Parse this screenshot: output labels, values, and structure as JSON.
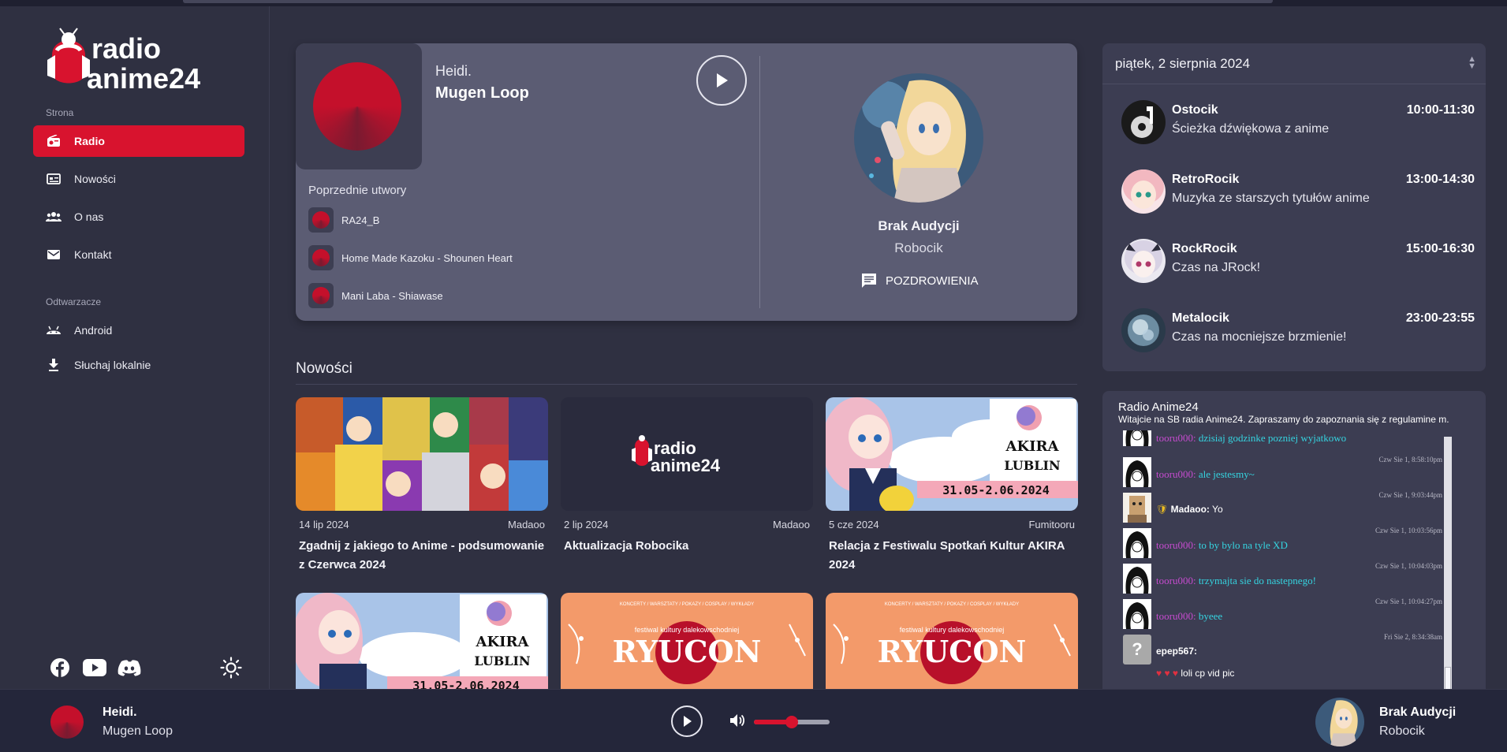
{
  "app": {
    "logo_text_line1": "radio",
    "logo_text_line2": "anime24",
    "accent_color": "#d8132e"
  },
  "sidebar": {
    "section_strona": "Strona",
    "section_odtwarzacze": "Odtwarzacze",
    "items": [
      {
        "label": "Radio",
        "icon": "radio-icon",
        "active": true
      },
      {
        "label": "Nowości",
        "icon": "news-icon"
      },
      {
        "label": "O nas",
        "icon": "people-icon"
      },
      {
        "label": "Kontakt",
        "icon": "mail-icon"
      }
    ],
    "players": [
      {
        "label": "Android",
        "icon": "android-icon"
      },
      {
        "label": "Słuchaj lokalnie",
        "icon": "download-icon"
      }
    ],
    "social": [
      "facebook-icon",
      "youtube-icon",
      "discord-icon"
    ],
    "theme_toggle": "sun-icon"
  },
  "now_playing": {
    "artist": "Heidi.",
    "title": "Mugen Loop",
    "previous_label": "Poprzednie utwory",
    "previous": [
      "RA24_B",
      "Home Made Kazoku - Shounen Heart",
      "Mani Laba - Shiawase"
    ],
    "host_name": "Brak Audycji",
    "host_sub": "Robocik",
    "greetings_label": "POZDROWIENIA"
  },
  "news": {
    "title": "Nowości",
    "cards": [
      {
        "date": "14 lip 2024",
        "author": "Madaoo",
        "headline": "Zgadnij z jakiego to Anime - podsumowanie z Czerwca 2024"
      },
      {
        "date": "2 lip 2024",
        "author": "Madaoo",
        "headline": "Aktualizacja Robocika"
      },
      {
        "date": "5 cze 2024",
        "author": "Fumitooru",
        "headline": "Relacja z Festiwalu Spotkań Kultur AKIRA 2024"
      }
    ],
    "thumb_text": {
      "akira": "AKIRA",
      "lublin": "LUBLIN",
      "akira_dates": "31.05-2.06.2024",
      "ryucon": "RYUCON",
      "ryucon_top": "KONCERTY / WARSZTATY / POKAZY / COSPLAY / WYKŁADY",
      "ryucon_sub": "festiwal kultury dalekowschodniej"
    }
  },
  "schedule": {
    "date": "piątek, 2 sierpnia 2024",
    "items": [
      {
        "name": "Ostocik",
        "time": "10:00-11:30",
        "desc": "Ścieżka dźwiękowa z anime"
      },
      {
        "name": "RetroRocik",
        "time": "13:00-14:30",
        "desc": "Muzyka ze starszych tytułów anime"
      },
      {
        "name": "RockRocik",
        "time": "15:00-16:30",
        "desc": "Czas na JRock!"
      },
      {
        "name": "Metalocik",
        "time": "23:00-23:55",
        "desc": "Czas na mocniejsze brzmienie!"
      }
    ]
  },
  "shoutbox": {
    "title": "Radio Anime24",
    "desc": "Witajcie na SB radia Anime24. Zapraszamy do zapoznania się z regulamine m.",
    "messages": [
      {
        "user": "tooru000:",
        "text": "dzisiaj godzinke pozniej wyjatkowo",
        "ts": ""
      },
      {
        "user": "tooru000:",
        "text": "ale jestesmy~",
        "ts": "Czw Sie 1, 8:58:10pm"
      },
      {
        "user": "Madaoo:",
        "text": "Yo",
        "ts": "Czw Sie 1, 9:03:44pm"
      },
      {
        "user": "tooru000:",
        "text": "to by bylo na tyle XD",
        "ts": "Czw Sie 1, 10:03:56pm"
      },
      {
        "user": "tooru000:",
        "text": "trzymajta sie do nastepnego!",
        "ts": "Czw Sie 1, 10:04:03pm"
      },
      {
        "user": "tooru000:",
        "text": "byeee",
        "ts": "Czw Sie 1, 10:04:27pm"
      },
      {
        "user": "epep567:",
        "text": "loli cp vid pic",
        "ts": "Fri Sie 2, 8:34:38am",
        "hearts": "♥ ♥ ♥"
      }
    ]
  },
  "bottom_player": {
    "artist": "Heidi.",
    "title": "Mugen Loop",
    "volume": 0.5,
    "host_name": "Brak Audycji",
    "host_sub": "Robocik"
  }
}
